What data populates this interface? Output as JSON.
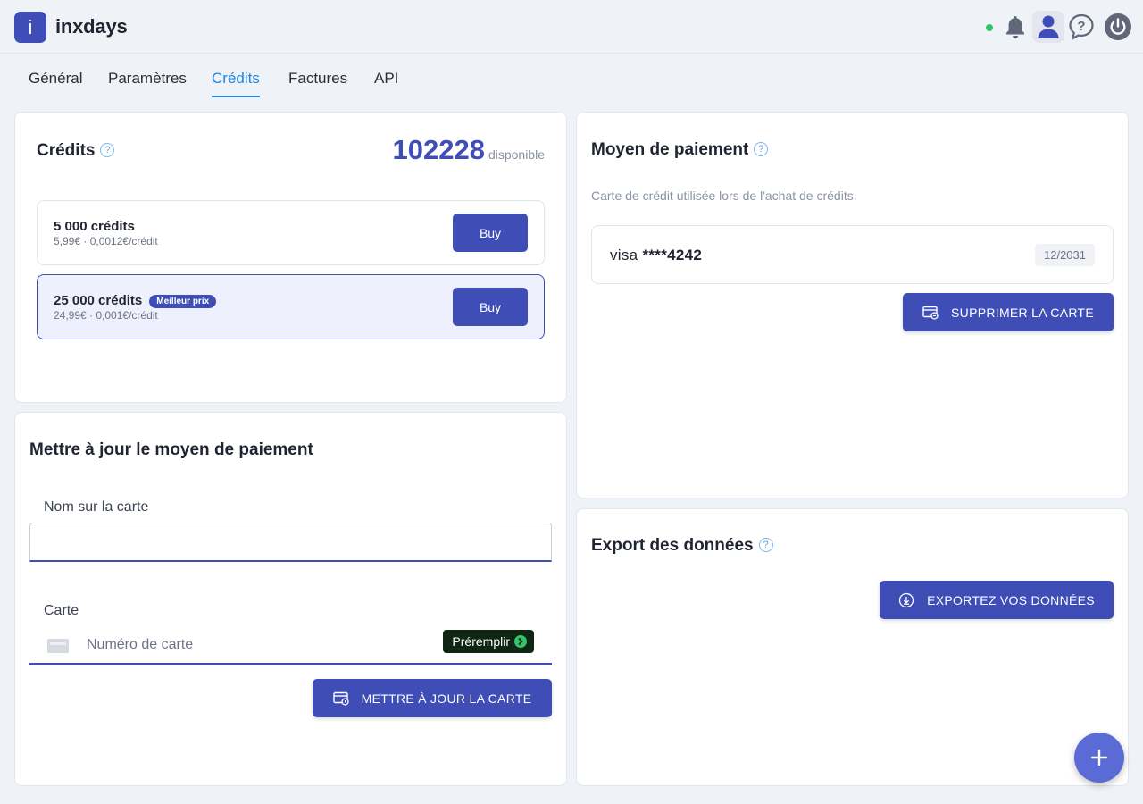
{
  "app": {
    "logo_letter": "i",
    "name": "inxdays"
  },
  "header": {
    "icons": [
      "bell-icon",
      "user-icon",
      "help-chat-icon",
      "power-icon"
    ],
    "status_color": "#36c46b"
  },
  "tabs": [
    {
      "label": "Général"
    },
    {
      "label": "Paramètres"
    },
    {
      "label": "Crédits",
      "active": true
    },
    {
      "label": "Factures"
    },
    {
      "label": "API"
    }
  ],
  "credits": {
    "title": "Crédits",
    "help": "?",
    "balance": "102228",
    "balance_label": "disponible",
    "packages": [
      {
        "name": "5 000 crédits",
        "price": "5,99€ · 0,0012€/crédit",
        "button": "Buy"
      },
      {
        "name": "25 000 crédits",
        "badge": "Meilleur prix",
        "price": "24,99€ · 0,001€/crédit",
        "button": "Buy"
      }
    ]
  },
  "update_payment": {
    "title": "Mettre à jour le moyen de paiement",
    "name_label": "Nom sur la carte",
    "name_value": "",
    "card_label": "Carte",
    "card_placeholder": "Numéro de carte",
    "prefill_label": "Préremplir",
    "submit_label": "METTRE À JOUR LA CARTE"
  },
  "payment_method": {
    "title": "Moyen de paiement",
    "help": "?",
    "description": "Carte de crédit utilisée lors de l'achat de crédits.",
    "card_brand": "visa",
    "card_masked": "****4242",
    "expiry": "12/2031",
    "delete_label": "SUPPRIMER LA CARTE"
  },
  "export": {
    "title": "Export des données",
    "help": "?",
    "button_label": "EXPORTEZ VOS DONNÉES"
  },
  "colors": {
    "accent": "#3f4eb6",
    "tab_active": "#1e88e5",
    "prefill_bg": "#0f2613",
    "fab": "#5a6bd6"
  }
}
